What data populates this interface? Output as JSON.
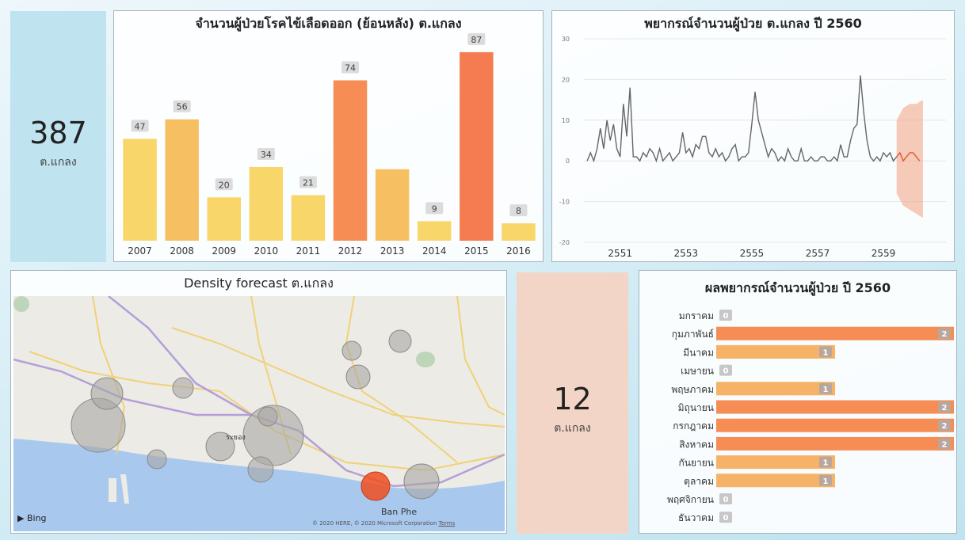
{
  "kpi_total": {
    "value": "387",
    "label": "ต.แกลง"
  },
  "kpi_forecast": {
    "value": "12",
    "label": "ต.แกลง"
  },
  "map": {
    "title": "Density forecast ต.แกลง",
    "brand": "Bing",
    "place_label": "Ban Phe",
    "city_label": "ระยอง",
    "attribution": "© 2020 HERE, © 2020 Microsoft Corporation",
    "terms": "Terms"
  },
  "colors": {
    "kpi_blue": "#bfe3ef",
    "kpi_pink": "#f3d5c7",
    "bar_yellow": "#f8d66a",
    "bar_orange": "#f58d55",
    "line_gray": "#666666",
    "forecast": "#e4572e"
  },
  "chart_data": [
    {
      "type": "bar",
      "title": "จำนวนผู้ป่วยโรคไข้เลือดออก (ย้อนหลัง) ต.แกลง",
      "categories": [
        "2007",
        "2008",
        "2009",
        "2010",
        "2011",
        "2012",
        "2013",
        "2014",
        "2015",
        "2016"
      ],
      "values": [
        47,
        56,
        20,
        34,
        21,
        74,
        33,
        9,
        87,
        8
      ],
      "data_labels": [
        "47",
        "56",
        "20",
        "34",
        "21",
        "74",
        "",
        "9",
        "87",
        "8"
      ],
      "colors": [
        "#f8d66a",
        "#f6c062",
        "#f8d66a",
        "#f8d66a",
        "#f8d66a",
        "#f58d55",
        "#f6c062",
        "#f8d66a",
        "#f47c50",
        "#f8d66a"
      ],
      "ylim": [
        0,
        95
      ]
    },
    {
      "type": "line",
      "title": "พยากรณ์จำนวนผู้ป่วย ต.แกลง ปี 2560",
      "x_ticks": [
        "2551",
        "2553",
        "2555",
        "2557",
        "2559"
      ],
      "y_ticks": [
        30,
        20,
        10,
        0,
        -10,
        -20
      ],
      "ylim": [
        -20,
        30
      ],
      "xlim": [
        2549.9,
        2560.9
      ],
      "series": [
        {
          "values": [
            [
              2550.0,
              0
            ],
            [
              2550.1,
              2
            ],
            [
              2550.2,
              0
            ],
            [
              2550.3,
              3
            ],
            [
              2550.4,
              8
            ],
            [
              2550.5,
              3
            ],
            [
              2550.6,
              10
            ],
            [
              2550.7,
              5
            ],
            [
              2550.8,
              9
            ],
            [
              2550.9,
              3
            ],
            [
              2551.0,
              1
            ],
            [
              2551.1,
              14
            ],
            [
              2551.2,
              6
            ],
            [
              2551.3,
              18
            ],
            [
              2551.4,
              1
            ],
            [
              2551.5,
              1
            ],
            [
              2551.6,
              0
            ],
            [
              2551.7,
              2
            ],
            [
              2551.8,
              1
            ],
            [
              2551.9,
              3
            ],
            [
              2552.0,
              2
            ],
            [
              2552.1,
              0
            ],
            [
              2552.2,
              3
            ],
            [
              2552.3,
              0
            ],
            [
              2552.4,
              1
            ],
            [
              2552.5,
              2
            ],
            [
              2552.6,
              0
            ],
            [
              2552.7,
              1
            ],
            [
              2552.8,
              2
            ],
            [
              2552.9,
              7
            ],
            [
              2553.0,
              2
            ],
            [
              2553.1,
              3
            ],
            [
              2553.2,
              1
            ],
            [
              2553.3,
              4
            ],
            [
              2553.4,
              3
            ],
            [
              2553.5,
              6
            ],
            [
              2553.6,
              6
            ],
            [
              2553.7,
              2
            ],
            [
              2553.8,
              1
            ],
            [
              2553.9,
              3
            ],
            [
              2554.0,
              1
            ],
            [
              2554.1,
              2
            ],
            [
              2554.2,
              0
            ],
            [
              2554.3,
              1
            ],
            [
              2554.4,
              3
            ],
            [
              2554.5,
              4
            ],
            [
              2554.6,
              0
            ],
            [
              2554.7,
              1
            ],
            [
              2554.8,
              1
            ],
            [
              2554.9,
              2
            ],
            [
              2555.0,
              9
            ],
            [
              2555.1,
              17
            ],
            [
              2555.2,
              10
            ],
            [
              2555.3,
              7
            ],
            [
              2555.4,
              4
            ],
            [
              2555.5,
              1
            ],
            [
              2555.6,
              3
            ],
            [
              2555.7,
              2
            ],
            [
              2555.8,
              0
            ],
            [
              2555.9,
              1
            ],
            [
              2556.0,
              0
            ],
            [
              2556.1,
              3
            ],
            [
              2556.2,
              1
            ],
            [
              2556.3,
              0
            ],
            [
              2556.4,
              0
            ],
            [
              2556.5,
              3
            ],
            [
              2556.6,
              0
            ],
            [
              2556.7,
              0
            ],
            [
              2556.8,
              1
            ],
            [
              2556.9,
              0
            ],
            [
              2557.0,
              0
            ],
            [
              2557.1,
              1
            ],
            [
              2557.2,
              1
            ],
            [
              2557.3,
              0
            ],
            [
              2557.4,
              0
            ],
            [
              2557.5,
              1
            ],
            [
              2557.6,
              0
            ],
            [
              2557.7,
              4
            ],
            [
              2557.8,
              1
            ],
            [
              2557.9,
              1
            ],
            [
              2558.0,
              5
            ],
            [
              2558.1,
              8
            ],
            [
              2558.2,
              9
            ],
            [
              2558.3,
              21
            ],
            [
              2558.4,
              12
            ],
            [
              2558.5,
              5
            ],
            [
              2558.6,
              1
            ],
            [
              2558.7,
              0
            ],
            [
              2558.8,
              1
            ],
            [
              2558.9,
              0
            ],
            [
              2559.0,
              2
            ],
            [
              2559.1,
              1
            ],
            [
              2559.2,
              2
            ],
            [
              2559.3,
              0
            ],
            [
              2559.4,
              1
            ]
          ]
        },
        {
          "values": [
            [
              2559.4,
              1
            ],
            [
              2559.5,
              2
            ],
            [
              2559.6,
              0
            ],
            [
              2559.7,
              1
            ],
            [
              2559.8,
              2
            ],
            [
              2559.9,
              2
            ],
            [
              2560.0,
              1
            ],
            [
              2560.1,
              0
            ]
          ]
        }
      ],
      "band": {
        "x": [
          2559.4,
          2559.6,
          2559.8,
          2560.0,
          2560.2
        ],
        "upper": [
          10,
          13,
          14,
          14,
          15
        ],
        "lower": [
          -8,
          -11,
          -12,
          -13,
          -14
        ]
      }
    },
    {
      "type": "bar",
      "orientation": "horizontal",
      "title": "ผลพยากรณ์จำนวนผู้ป่วย ปี 2560",
      "categories": [
        "มกราคม",
        "กุมภาพันธ์",
        "มีนาคม",
        "เมษายน",
        "พฤษภาคม",
        "มิถุนายน",
        "กรกฎาคม",
        "สิงหาคม",
        "กันยายน",
        "ตุลาคม",
        "พฤศจิกายน",
        "ธันวาคม"
      ],
      "values": [
        0,
        2,
        1,
        0,
        1,
        2,
        2,
        2,
        1,
        1,
        0,
        0
      ],
      "xlim": [
        0,
        2
      ]
    }
  ]
}
